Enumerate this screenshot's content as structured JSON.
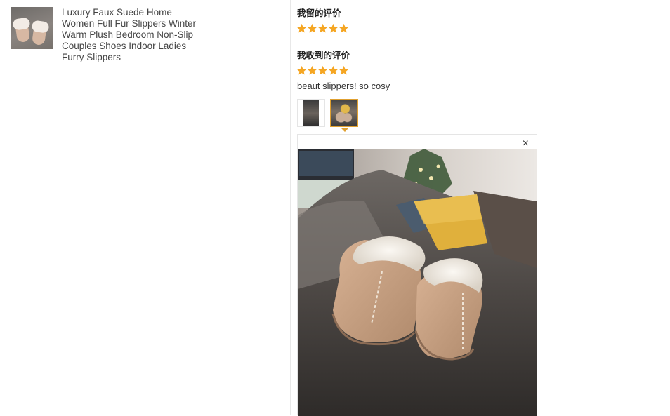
{
  "product": {
    "title": "Luxury Faux Suede Home Women Full Fur Slippers Winter Warm Plush Bedroom Non-Slip Couples Shoes Indoor Ladies Furry Slippers",
    "thumbnail_icon": "slippers-photo"
  },
  "my_review": {
    "label": "我留的评价",
    "rating": 5,
    "max_rating": 5
  },
  "received_review": {
    "label": "我收到的评价",
    "rating": 5,
    "max_rating": 5,
    "text": "beaut slippers! so cosy",
    "photos": [
      {
        "icon": "review-photo-1",
        "selected": false
      },
      {
        "icon": "review-photo-2",
        "selected": true
      }
    ]
  },
  "viewer": {
    "close_label": "×",
    "close_icon": "close-icon"
  },
  "colors": {
    "star": "#f5a623",
    "accent_border": "#e0a030",
    "divider": "#e8e8e8"
  }
}
